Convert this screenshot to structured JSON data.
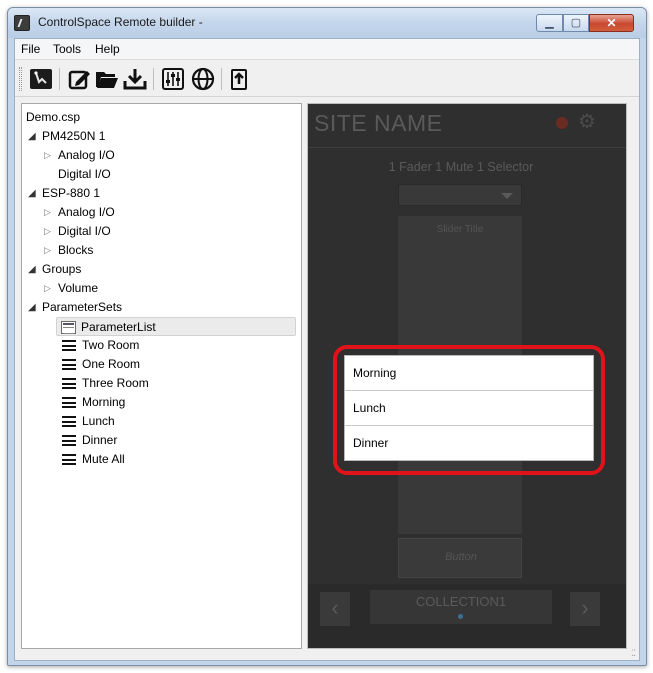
{
  "window": {
    "title": "ControlSpace Remote builder -"
  },
  "menu": [
    "File",
    "Tools",
    "Help"
  ],
  "toolbar": {
    "icons": [
      "designer-icon",
      "edit-icon",
      "open-folder-icon",
      "download-icon",
      "mixer-icon",
      "globe-icon",
      "upload-icon"
    ]
  },
  "tree": {
    "root": "Demo.csp",
    "nodes": [
      {
        "label": "PM4250N 1"
      },
      {
        "label": "Analog I/O"
      },
      {
        "label": "Digital I/O"
      },
      {
        "label": "ESP-880 1"
      },
      {
        "label": "Analog I/O"
      },
      {
        "label": "Digital I/O"
      },
      {
        "label": "Blocks"
      },
      {
        "label": "Groups"
      },
      {
        "label": "Volume"
      },
      {
        "label": "ParameterSets"
      },
      {
        "label": "ParameterList"
      },
      {
        "label": "Two Room"
      },
      {
        "label": "One Room"
      },
      {
        "label": "Three Room"
      },
      {
        "label": "Morning"
      },
      {
        "label": "Lunch"
      },
      {
        "label": "Dinner"
      },
      {
        "label": "Mute All"
      }
    ]
  },
  "preview": {
    "site_name": "SITE NAME",
    "group_title": "1 Fader 1 Mute 1 Selector",
    "slider_title": "Slider Title",
    "button_label": "Button",
    "prev_glyph": "‹",
    "next_glyph": "›",
    "collection": "COLLECTION1"
  },
  "popup": {
    "items": [
      "Morning",
      "Lunch",
      "Dinner"
    ],
    "highlight_color": "#e0131b"
  }
}
